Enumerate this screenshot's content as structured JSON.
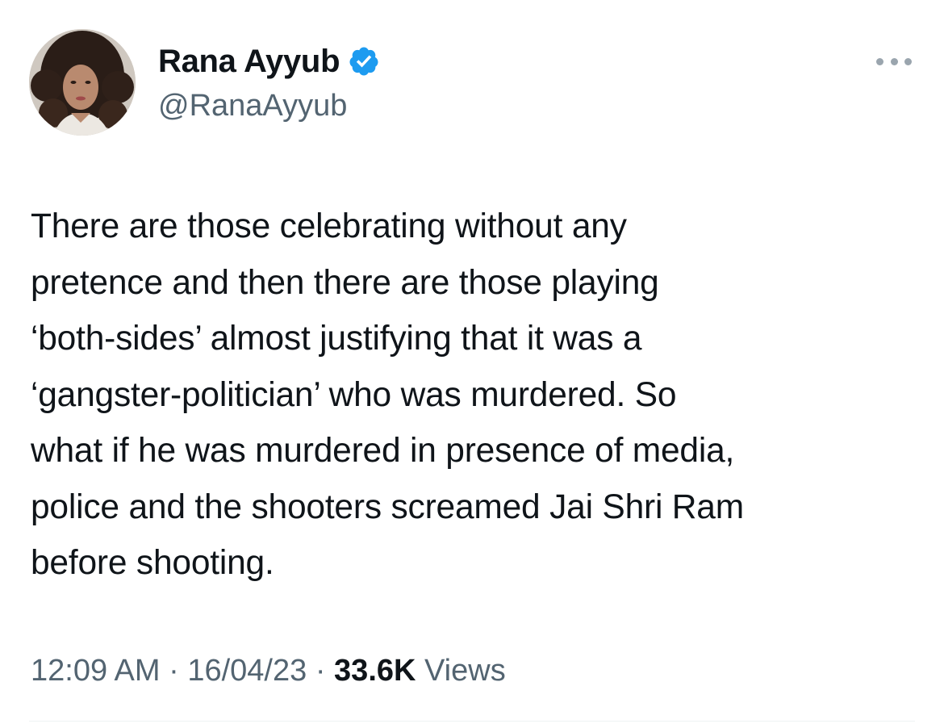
{
  "author": {
    "name": "Rana Ayyub",
    "handle": "@RanaAyyub",
    "verified_icon": "verified-badge-icon",
    "accent_color": "#1d9bf0"
  },
  "menu": {
    "icon": "more-options-icon"
  },
  "tweet": {
    "lines": [
      "There are those celebrating without any",
      "pretence and then there are those playing",
      "‘both-sides’ almost justifying that it was a",
      "‘gangster-politician’ who was murdered. So",
      "what if he was murdered in presence of media,",
      "police and the shooters screamed Jai Shri Ram",
      "before shooting."
    ]
  },
  "meta": {
    "time": "12:09 AM",
    "separator": "·",
    "date": "16/04/23",
    "views_count": "33.6K",
    "views_label": "Views"
  }
}
